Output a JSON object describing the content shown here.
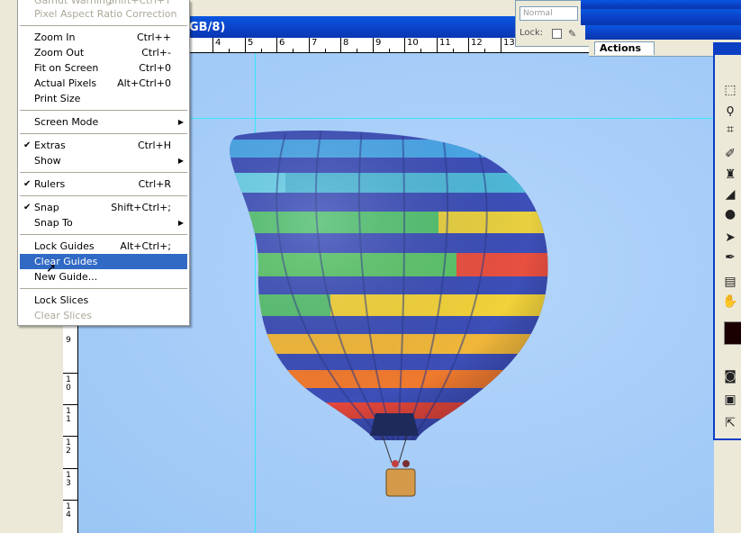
{
  "document": {
    "title_fragment": "GB/8)",
    "ruler_numbers": [
      "4",
      "5",
      "6",
      "7",
      "8",
      "9",
      "10",
      "11",
      "12",
      "13"
    ],
    "vruler_numbers": [
      "9",
      "1 0",
      "1 1",
      "1 2",
      "1 3",
      "1 4"
    ]
  },
  "layers_palette": {
    "blend_mode": "Normal",
    "lock_label": "Lock:"
  },
  "actions_palette": {
    "tab_label": "Actions"
  },
  "view_menu": {
    "items": [
      {
        "label": "Gamut Warning",
        "shortcut": "Shift+Ctrl+Y",
        "disabled": true
      },
      {
        "label": "Pixel Aspect Ratio Correction",
        "shortcut": "",
        "disabled": true
      },
      {
        "label": "Zoom In",
        "shortcut": "Ctrl++"
      },
      {
        "label": "Zoom Out",
        "shortcut": "Ctrl+-"
      },
      {
        "label": "Fit on Screen",
        "shortcut": "Ctrl+0"
      },
      {
        "label": "Actual Pixels",
        "shortcut": "Alt+Ctrl+0"
      },
      {
        "label": "Print Size",
        "shortcut": ""
      },
      {
        "label": "Screen Mode",
        "shortcut": "",
        "submenu": true
      },
      {
        "label": "Extras",
        "shortcut": "Ctrl+H",
        "checked": true
      },
      {
        "label": "Show",
        "shortcut": "",
        "submenu": true
      },
      {
        "label": "Rulers",
        "shortcut": "Ctrl+R",
        "checked": true
      },
      {
        "label": "Snap",
        "shortcut": "Shift+Ctrl+;",
        "checked": true
      },
      {
        "label": "Snap To",
        "shortcut": "",
        "submenu": true
      },
      {
        "label": "Lock Guides",
        "shortcut": "Alt+Ctrl+;"
      },
      {
        "label": "Clear Guides",
        "shortcut": "",
        "highlighted": true
      },
      {
        "label": "New Guide...",
        "shortcut": ""
      },
      {
        "label": "Lock Slices",
        "shortcut": ""
      },
      {
        "label": "Clear Slices",
        "shortcut": "",
        "disabled": true
      }
    ]
  },
  "icons": [
    "marquee-icon",
    "lasso-icon",
    "crop-icon",
    "healing-brush-icon",
    "stamp-icon",
    "eraser-icon",
    "blur-icon",
    "path-select-icon",
    "pen-icon",
    "notes-icon",
    "hand-icon",
    "quick-mask-icon",
    "screen-mode-icon",
    "jump-to-icon"
  ],
  "colors": {
    "accent": "#316ac5",
    "titlebar": "#0b3fc3",
    "guide": "#38e8f5",
    "foreground": "#1a0000"
  }
}
